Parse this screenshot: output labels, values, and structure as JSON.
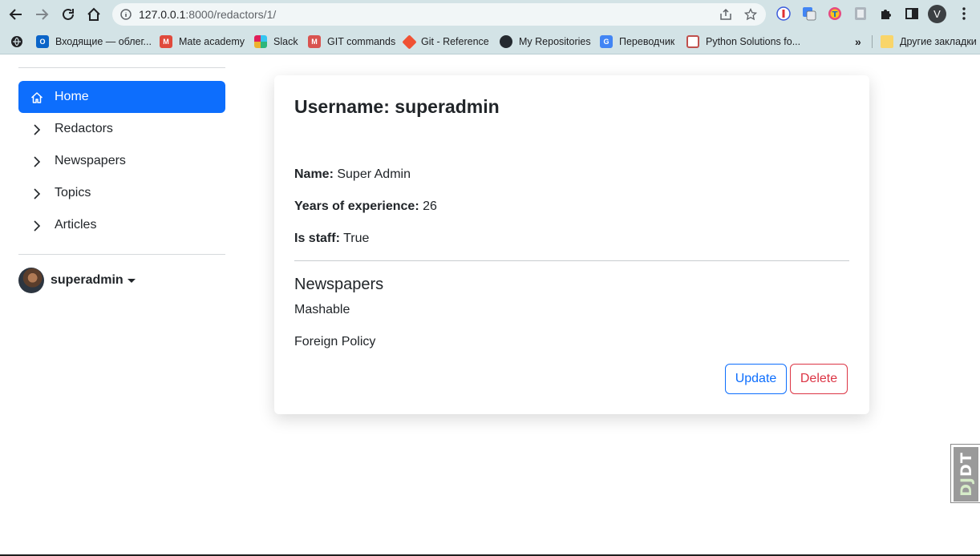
{
  "browser": {
    "url_host": "127.0.0.1",
    "url_path": ":8000/redactors/1/",
    "profile_initial": "V",
    "bookmarks": [
      {
        "label": "Входящие — облег...",
        "icon": "outlook-icon",
        "color": "#0a64c8"
      },
      {
        "label": "Mate academy",
        "icon": "mate-academy-icon",
        "color": "#e04a3c"
      },
      {
        "label": "Slack",
        "icon": "slack-icon",
        "color": "#4a154b"
      },
      {
        "label": "GIT commands",
        "icon": "git-commands-icon",
        "color": "#d9534f"
      },
      {
        "label": "Git - Reference",
        "icon": "git-icon",
        "color": "#f05133"
      },
      {
        "label": "My Repositories",
        "icon": "github-icon",
        "color": "#24292f"
      },
      {
        "label": "Переводчик",
        "icon": "translate-icon",
        "color": "#4285f4"
      },
      {
        "label": "Python Solutions fo...",
        "icon": "python-solutions-icon",
        "color": "#c0504d"
      }
    ],
    "other_bookmarks": "Другие закладки"
  },
  "sidebar": {
    "items": [
      {
        "label": "Home",
        "active": true
      },
      {
        "label": "Redactors",
        "active": false
      },
      {
        "label": "Newspapers",
        "active": false
      },
      {
        "label": "Topics",
        "active": false
      },
      {
        "label": "Articles",
        "active": false
      }
    ],
    "user": {
      "name": "superadmin"
    }
  },
  "detail": {
    "title": "Username: superadmin",
    "fields": [
      {
        "label": "Name:",
        "value": "Super Admin"
      },
      {
        "label": "Years of experience:",
        "value": "26"
      },
      {
        "label": "Is staff:",
        "value": "True"
      }
    ],
    "newspapers_heading": "Newspapers",
    "newspapers": [
      "Mashable",
      "Foreign Policy"
    ],
    "update_label": "Update",
    "delete_label": "Delete"
  },
  "colors": {
    "primary": "#0d6efd",
    "danger": "#dc3545",
    "browser_chrome": "#d3e3e6"
  },
  "debug_toolbar": {
    "label_dj": "DJ",
    "label_dt": "DT"
  }
}
